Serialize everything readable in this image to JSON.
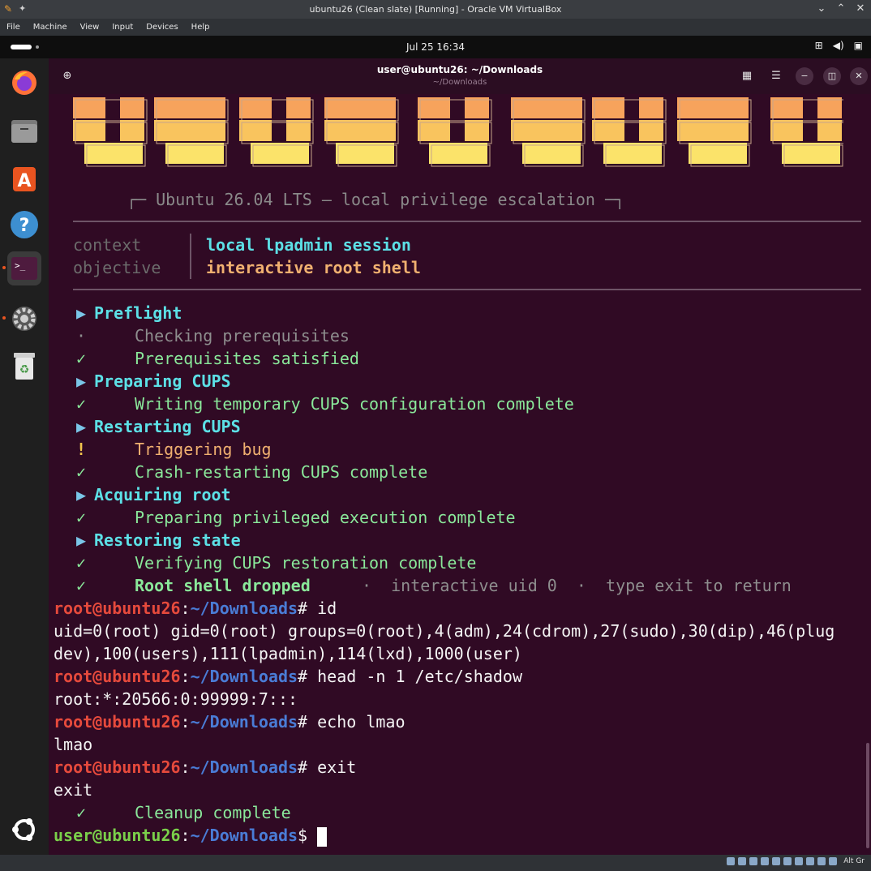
{
  "vbox": {
    "title": "ubuntu26 (Clean slate) [Running] - Oracle VM VirtualBox",
    "menu": [
      "File",
      "Machine",
      "View",
      "Input",
      "Devices",
      "Help"
    ],
    "host_key": "Alt Gr"
  },
  "topbar": {
    "clock": "Jul 25  16:34"
  },
  "dock": {
    "items": [
      "firefox-icon",
      "files-icon",
      "app-center-icon",
      "help-icon",
      "terminal-icon",
      "settings-icon",
      "trash-icon"
    ],
    "show_apps": "ubuntu-logo-icon",
    "active_accent": "#e95420"
  },
  "terminal": {
    "title": "user@ubuntu26: ~/Downloads",
    "subtitle": "~/Downloads",
    "banner_colors": [
      "#f7a35c",
      "#f9c45e",
      "#fbe36a"
    ],
    "banner_subtitle": "┌─ Ubuntu 26.04 LTS — local privilege escalation ─┐",
    "context_label": "context",
    "context_value": "local lpadmin session",
    "objective_label": "objective",
    "objective_value": "interactive root shell",
    "steps": [
      {
        "mark": "▶",
        "text": "Preflight",
        "kind": "step"
      },
      {
        "mark": "·",
        "text": "Checking prerequisites",
        "kind": "dim"
      },
      {
        "mark": "✓",
        "text": "Prerequisites satisfied",
        "kind": "ok"
      },
      {
        "mark": "▶",
        "text": "Preparing CUPS",
        "kind": "step"
      },
      {
        "mark": "✓",
        "text": "Writing temporary CUPS configuration complete",
        "kind": "ok"
      },
      {
        "mark": "▶",
        "text": "Restarting CUPS",
        "kind": "step"
      },
      {
        "mark": "!",
        "text": "Triggering bug",
        "kind": "warn"
      },
      {
        "mark": "✓",
        "text": "Crash-restarting CUPS complete",
        "kind": "ok"
      },
      {
        "mark": "▶",
        "text": "Acquiring root",
        "kind": "step"
      },
      {
        "mark": "✓",
        "text": "Preparing privileged execution complete",
        "kind": "ok"
      },
      {
        "mark": "▶",
        "text": "Restoring state",
        "kind": "step"
      },
      {
        "mark": "✓",
        "text": "Verifying CUPS restoration complete",
        "kind": "ok"
      }
    ],
    "final": {
      "mark": "✓",
      "text": "Root shell dropped",
      "note": "·  interactive uid 0  ·  type exit to return"
    },
    "session": [
      {
        "type": "prompt",
        "user": "root@ubuntu26",
        "path": "~/Downloads",
        "sym": "#",
        "cmd": " id"
      },
      {
        "type": "out",
        "text": "uid=0(root) gid=0(root) groups=0(root),4(adm),24(cdrom),27(sudo),30(dip),46(plug"
      },
      {
        "type": "out",
        "text": "dev),100(users),111(lpadmin),114(lxd),1000(user)"
      },
      {
        "type": "prompt",
        "user": "root@ubuntu26",
        "path": "~/Downloads",
        "sym": "#",
        "cmd": " head -n 1 /etc/shadow"
      },
      {
        "type": "out",
        "text": "root:*:20566:0:99999:7:::"
      },
      {
        "type": "prompt",
        "user": "root@ubuntu26",
        "path": "~/Downloads",
        "sym": "#",
        "cmd": " echo lmao"
      },
      {
        "type": "out",
        "text": "lmao"
      },
      {
        "type": "prompt",
        "user": "root@ubuntu26",
        "path": "~/Downloads",
        "sym": "#",
        "cmd": " exit"
      },
      {
        "type": "out",
        "text": "exit"
      }
    ],
    "cleanup": {
      "mark": "✓",
      "text": "Cleanup complete"
    },
    "final_prompt": {
      "user": "user@ubuntu26",
      "path": "~/Downloads",
      "sym": "$"
    }
  }
}
